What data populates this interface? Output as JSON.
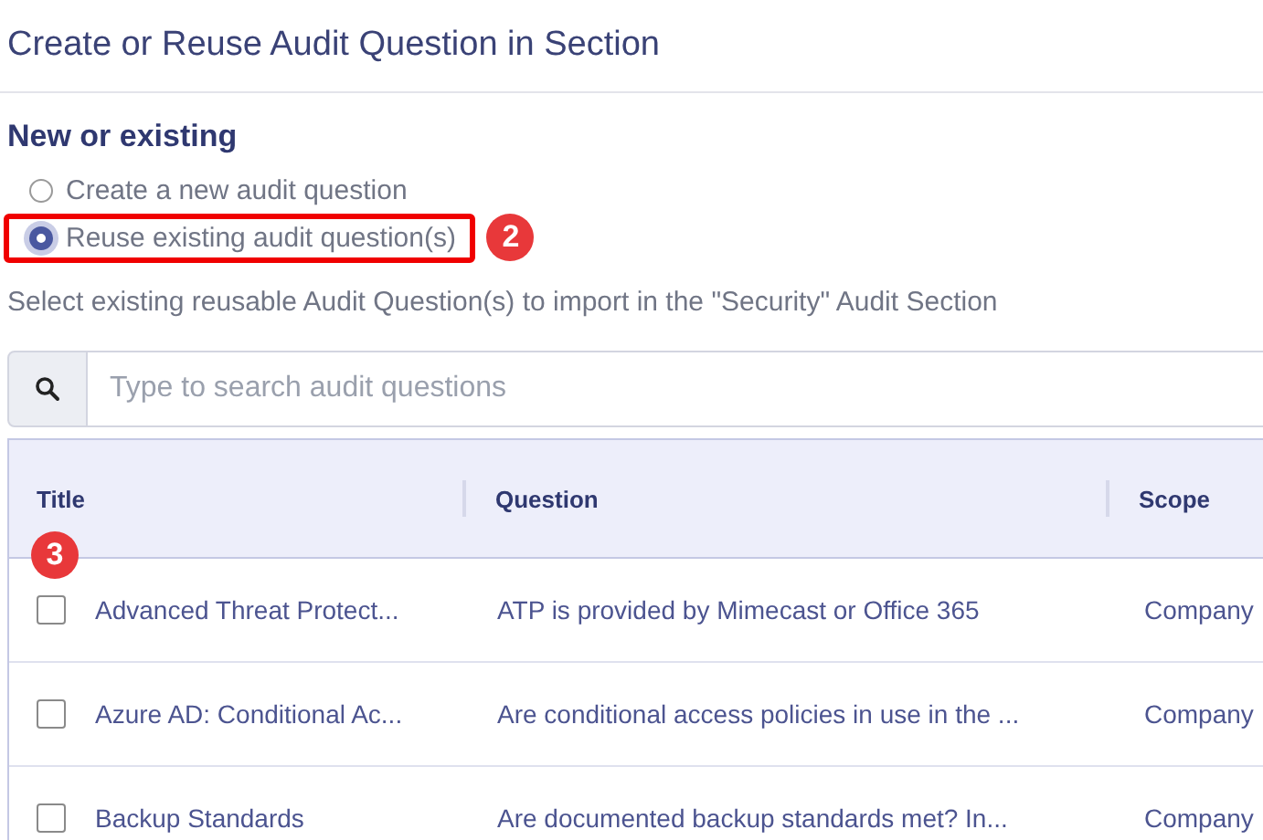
{
  "dialog": {
    "title": "Create or Reuse Audit Question in Section"
  },
  "section_heading": "New or existing",
  "options": [
    {
      "label": "Create a new audit question",
      "selected": false,
      "highlighted": false
    },
    {
      "label": "Reuse existing audit question(s)",
      "selected": true,
      "highlighted": true,
      "annotation": "2"
    }
  ],
  "hint": "Select existing reusable Audit Question(s) to import in the \"Security\" Audit Section",
  "search": {
    "placeholder": "Type to search audit questions"
  },
  "table": {
    "columns": [
      "Title",
      "Question",
      "Scope"
    ],
    "annotation": "3",
    "rows": [
      {
        "checked": false,
        "cells": [
          "Advanced Threat Protect...",
          "ATP is provided by Mimecast or Office 365",
          "Company"
        ]
      },
      {
        "checked": false,
        "cells": [
          "Azure AD: Conditional Ac...",
          "Are conditional access policies in use in the ...",
          "Company"
        ]
      },
      {
        "checked": false,
        "cells": [
          "Backup Standards",
          "Are documented backup standards met? In...",
          "Company"
        ]
      }
    ]
  }
}
